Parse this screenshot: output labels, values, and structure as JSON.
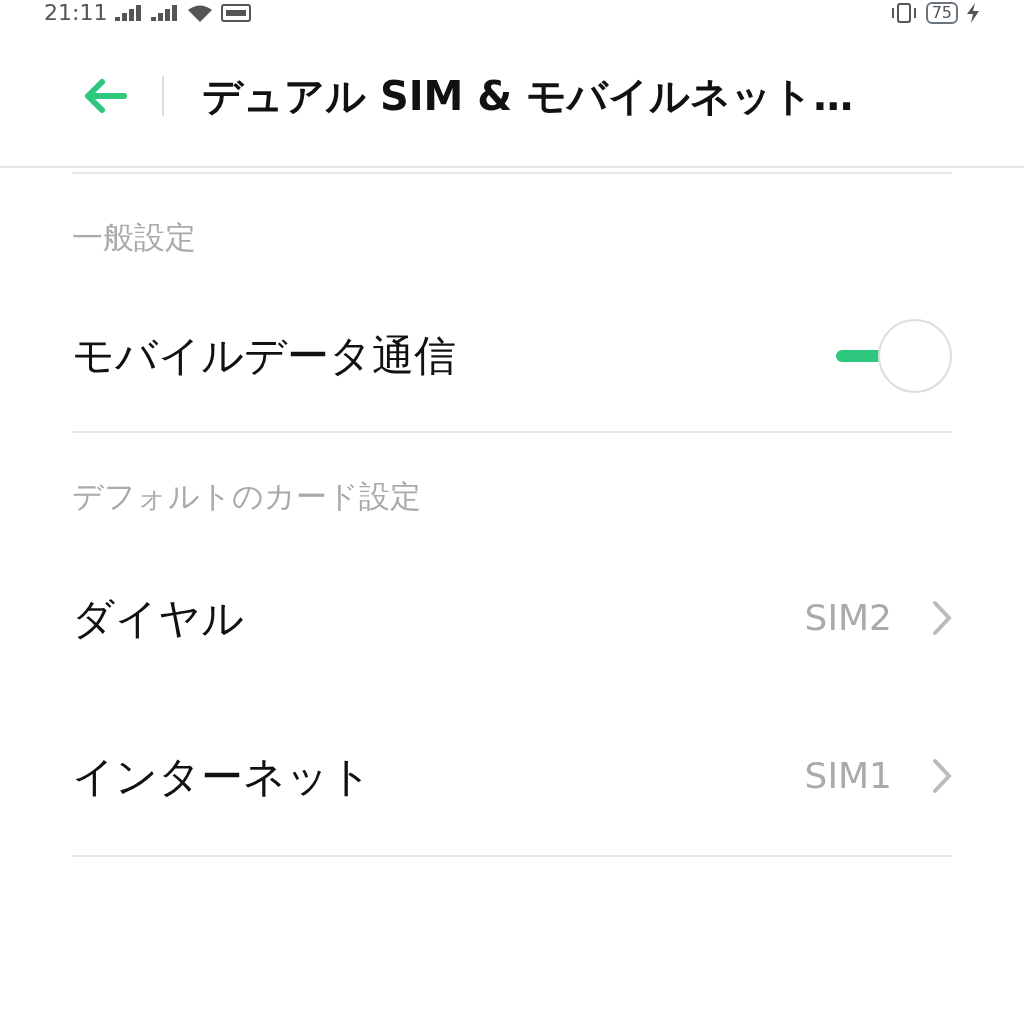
{
  "status_bar": {
    "time": "21:11",
    "battery": "75"
  },
  "header": {
    "title": "デュアル SIM & モバイルネット…"
  },
  "sections": [
    {
      "title": "一般設定",
      "items": [
        {
          "kind": "toggle",
          "label": "モバイルデータ通信",
          "on": true
        }
      ]
    },
    {
      "title": "デフォルトのカード設定",
      "items": [
        {
          "kind": "link",
          "label": "ダイヤル",
          "value": "SIM2"
        },
        {
          "kind": "link",
          "label": "インターネット",
          "value": "SIM1"
        }
      ]
    }
  ]
}
